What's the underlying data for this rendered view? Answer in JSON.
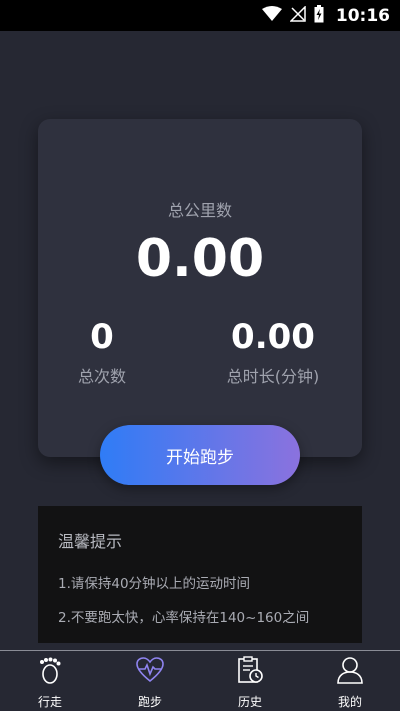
{
  "status_bar": {
    "time": "10:16"
  },
  "summary": {
    "total_km_label": "总公里数",
    "total_km_value": "0.00",
    "total_count_value": "0",
    "total_count_label": "总次数",
    "total_duration_value": "0.00",
    "total_duration_label": "总时长(分钟)"
  },
  "start_button": {
    "label": "开始跑步"
  },
  "tips": {
    "title": "温馨提示",
    "line1": "1.请保持40分钟以上的运动时间",
    "line2": "2.不要跑太快，心率保持在140~160之间"
  },
  "nav": {
    "items": [
      {
        "label": "行走",
        "icon": "footprint-icon"
      },
      {
        "label": "跑步",
        "icon": "heartbeat-icon",
        "active": true
      },
      {
        "label": "历史",
        "icon": "history-icon"
      },
      {
        "label": "我的",
        "icon": "profile-icon"
      }
    ]
  },
  "colors": {
    "background": "#262833",
    "card": "#2f313e",
    "accent_start": "#2f7cf6",
    "accent_end": "#8b72de",
    "active_nav": "#8f84f0"
  }
}
